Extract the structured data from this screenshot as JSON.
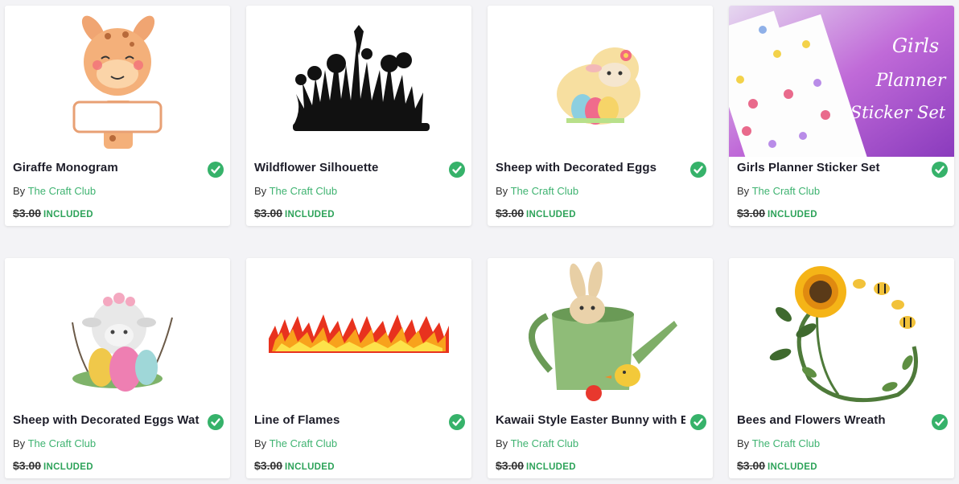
{
  "products": [
    {
      "title": "Giraffe Monogram",
      "by_label": "By",
      "author": "The Craft Club",
      "price": "$3.00",
      "status": "INCLUDED",
      "thumb": "giraffe-monogram"
    },
    {
      "title": "Wildflower Silhouette",
      "by_label": "By",
      "author": "The Craft Club",
      "price": "$3.00",
      "status": "INCLUDED",
      "thumb": "wildflower-silhouette"
    },
    {
      "title": "Sheep with Decorated Eggs",
      "by_label": "By",
      "author": "The Craft Club",
      "price": "$3.00",
      "status": "INCLUDED",
      "thumb": "sheep-eggs"
    },
    {
      "title": "Girls Planner Sticker Set",
      "by_label": "By",
      "author": "The Craft Club",
      "price": "$3.00",
      "status": "INCLUDED",
      "thumb": "planner-stickers",
      "thumb_text": [
        "Girls",
        "Planner",
        "Sticker Set"
      ]
    },
    {
      "title": "Sheep with Decorated Eggs Wat",
      "by_label": "By",
      "author": "The Craft Club",
      "price": "$3.00",
      "status": "INCLUDED",
      "thumb": "sheep-eggs-watercolor"
    },
    {
      "title": "Line of Flames",
      "by_label": "By",
      "author": "The Craft Club",
      "price": "$3.00",
      "status": "INCLUDED",
      "thumb": "flames"
    },
    {
      "title": "Kawaii Style Easter Bunny with E",
      "by_label": "By",
      "author": "The Craft Club",
      "price": "$3.00",
      "status": "INCLUDED",
      "thumb": "bunny-watering-can"
    },
    {
      "title": "Bees and Flowers Wreath",
      "by_label": "By",
      "author": "The Craft Club",
      "price": "$3.00",
      "status": "INCLUDED",
      "thumb": "bees-wreath"
    }
  ],
  "colors": {
    "accent_green": "#36b26a",
    "included_green": "#2ea35a",
    "title": "#1e1e2a"
  },
  "icons": {
    "included_badge": "check-circle-icon"
  }
}
